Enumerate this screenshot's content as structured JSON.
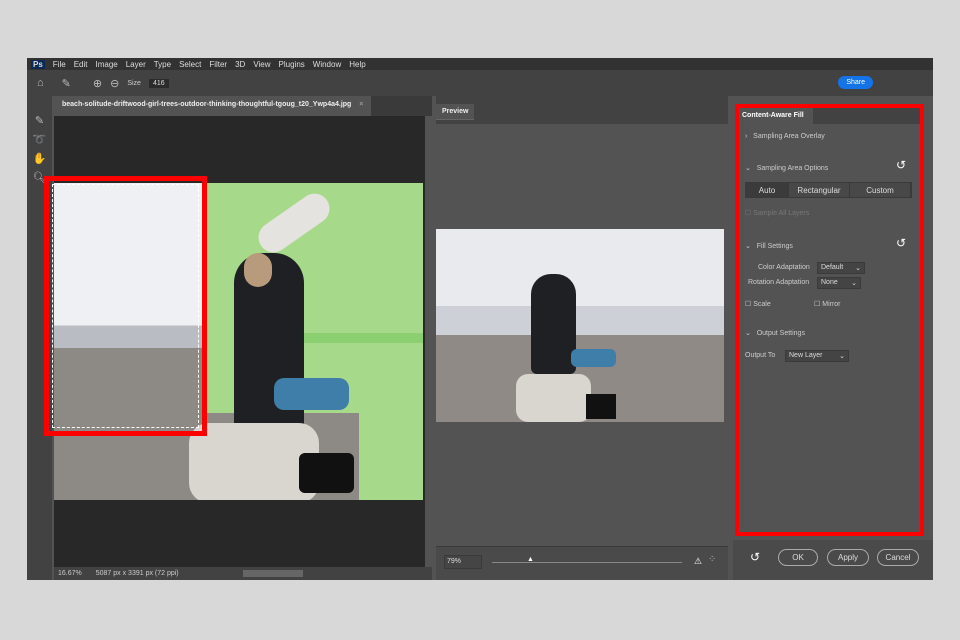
{
  "app": {
    "logo": "Ps",
    "menu": [
      "File",
      "Edit",
      "Image",
      "Layer",
      "Type",
      "Select",
      "Filter",
      "3D",
      "View",
      "Plugins",
      "Window",
      "Help"
    ]
  },
  "options": {
    "size_label": "Size",
    "size_value": "416",
    "share": "Share"
  },
  "document": {
    "tab_title": "beach-solitude-driftwood-girl-trees-outdoor-thinking-thoughtful-tgoug_t20_Ywp4a4.jpg",
    "zoom": "16.67%",
    "dimensions": "5087 px x 3391 px (72 ppi)"
  },
  "preview": {
    "tab": "Preview",
    "zoom": "79%",
    "zoom_fraction": 0.2
  },
  "content_aware_fill": {
    "title": "Content-Aware Fill",
    "sampling_overlay": "Sampling Area Overlay",
    "sampling_options": "Sampling Area Options",
    "modes": [
      "Auto",
      "Rectangular",
      "Custom"
    ],
    "sample_all_layers": "Sample All Layers",
    "fill_settings": "Fill Settings",
    "color_adaptation_label": "Color Adaptation",
    "color_adaptation": "Default",
    "rotation_adaptation_label": "Rotation Adaptation",
    "rotation_adaptation": "None",
    "scale": "Scale",
    "mirror": "Mirror",
    "output_settings": "Output Settings",
    "output_to_label": "Output To",
    "output_to": "New Layer",
    "ok": "OK",
    "apply": "Apply",
    "cancel": "Cancel"
  }
}
